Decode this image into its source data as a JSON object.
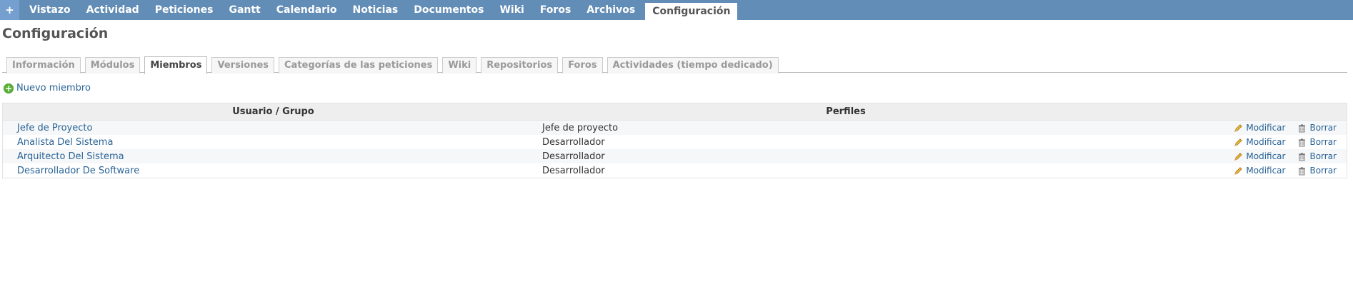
{
  "menu": {
    "plus_label": "+",
    "items": [
      "Vistazo",
      "Actividad",
      "Peticiones",
      "Gantt",
      "Calendario",
      "Noticias",
      "Documentos",
      "Wiki",
      "Foros",
      "Archivos"
    ],
    "selected": "Configuración"
  },
  "page": {
    "title": "Configuración"
  },
  "tabs": [
    {
      "label": "Información"
    },
    {
      "label": "Módulos"
    },
    {
      "label": "Miembros"
    },
    {
      "label": "Versiones"
    },
    {
      "label": "Categorías de las peticiones"
    },
    {
      "label": "Wiki"
    },
    {
      "label": "Repositorios"
    },
    {
      "label": "Foros"
    },
    {
      "label": "Actividades (tiempo dedicado)"
    }
  ],
  "new_member": {
    "label": "Nuevo miembro"
  },
  "table": {
    "headers": {
      "user": "Usuario / Grupo",
      "roles": "Perfiles"
    },
    "edit_label": "Modificar",
    "delete_label": "Borrar",
    "rows": [
      {
        "user": "Jefe de Proyecto",
        "role": "Jefe de proyecto"
      },
      {
        "user": "Analista Del Sistema",
        "role": "Desarrollador"
      },
      {
        "user": "Arquitecto Del Sistema",
        "role": "Desarrollador"
      },
      {
        "user": "Desarrollador De Software",
        "role": "Desarrollador"
      }
    ]
  },
  "colors": {
    "menu_bg": "#628db6",
    "link": "#2a6496"
  },
  "icons": {
    "add": "add-icon",
    "edit": "pencil-icon",
    "delete": "trash-icon"
  }
}
